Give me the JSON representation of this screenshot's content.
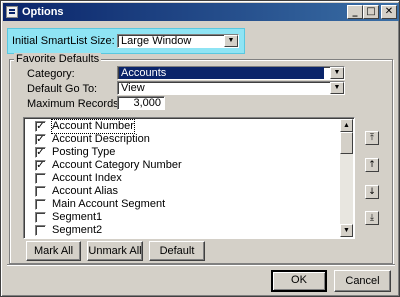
{
  "window": {
    "title": "Options",
    "minimize_glyph": "_",
    "maximize_glyph": "□",
    "close_glyph": "✕"
  },
  "smartlist": {
    "label": "Initial SmartList Size:",
    "value": "Large Window"
  },
  "favorite_defaults": {
    "title": "Favorite Defaults",
    "category_label": "Category:",
    "category_value": "Accounts",
    "default_goto_label": "Default Go To:",
    "default_goto_value": "View",
    "max_records_label": "Maximum Records:",
    "max_records_value": "3,000"
  },
  "columns": [
    {
      "label": "Account Number",
      "checked": true,
      "check_glyph": "✓"
    },
    {
      "label": "Account Description",
      "checked": true,
      "check_glyph": "✓"
    },
    {
      "label": "Posting Type",
      "checked": true,
      "check_glyph": "✓"
    },
    {
      "label": "Account Category Number",
      "checked": true,
      "check_glyph": "✓"
    },
    {
      "label": "Account Index",
      "checked": false,
      "check_glyph": ""
    },
    {
      "label": "Account Alias",
      "checked": false,
      "check_glyph": ""
    },
    {
      "label": "Main Account Segment",
      "checked": false,
      "check_glyph": ""
    },
    {
      "label": "Segment1",
      "checked": false,
      "check_glyph": ""
    },
    {
      "label": "Segment2",
      "checked": false,
      "check_glyph": ""
    }
  ],
  "list_buttons": {
    "mark_all": "Mark All",
    "unmark_all": "Unmark All",
    "default": "Default"
  },
  "move_buttons": {
    "top": "⤒",
    "up": "↑",
    "down": "↓",
    "bottom": "⤓"
  },
  "dialog_buttons": {
    "ok": "OK",
    "cancel": "Cancel"
  },
  "icons": {
    "app": "options-window-icon",
    "dropdown": "chevron-down-icon"
  },
  "colors": {
    "titlebar": "#0a246a",
    "highlight_band": "#8fe4f4",
    "selection": "#0a246a",
    "face": "#d4d0c8"
  }
}
